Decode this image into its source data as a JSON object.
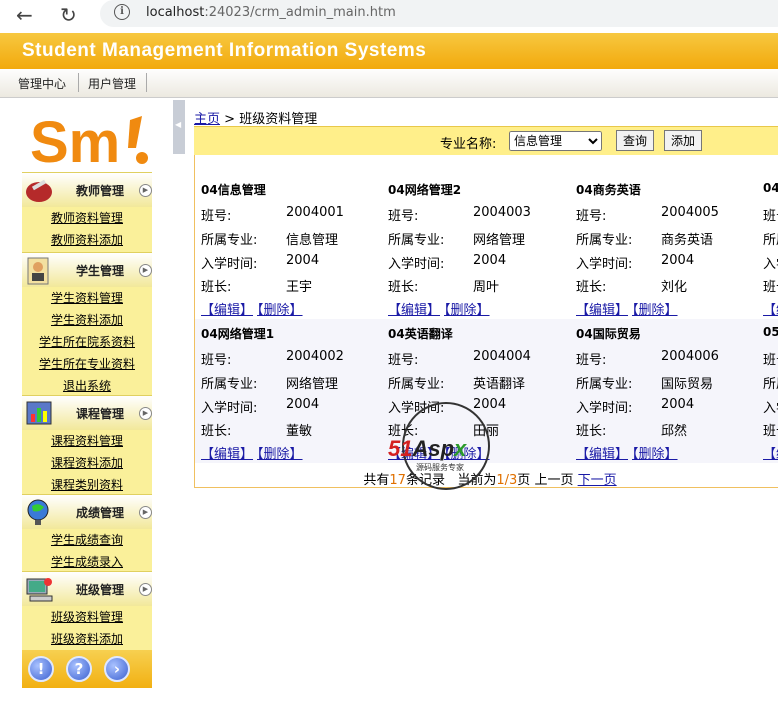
{
  "browser": {
    "url_host": "localhost",
    "url_rest": ":24023/crm_admin_main.htm"
  },
  "app": {
    "title": "Student Management Information Systems",
    "top_menu": [
      "管理中心",
      "用户管理"
    ]
  },
  "sidebar": {
    "sections": [
      {
        "label": "教师管理",
        "icon": "teacher-tools-icon",
        "items": [
          "教师资料管理",
          "教师资料添加"
        ]
      },
      {
        "label": "学生管理",
        "icon": "student-icon",
        "items": [
          "学生资料管理",
          "学生资料添加",
          "学生所在院系资料",
          "学生所在专业资料",
          "退出系统"
        ]
      },
      {
        "label": "课程管理",
        "icon": "course-chart-icon",
        "items": [
          "课程资料管理",
          "课程资料添加",
          "课程类别资料"
        ]
      },
      {
        "label": "成绩管理",
        "icon": "score-globe-icon",
        "items": [
          "学生成绩查询",
          "学生成绩录入"
        ]
      },
      {
        "label": "班级管理",
        "icon": "class-computer-icon",
        "items": [
          "班级资料管理",
          "班级资料添加"
        ]
      }
    ],
    "footer_icons": [
      "info-icon",
      "help-icon",
      "forward-icon"
    ]
  },
  "breadcrumb": {
    "home": "主页",
    "sep": ">",
    "current": "班级资料管理"
  },
  "toolbar": {
    "label": "专业名称:",
    "selected": "信息管理",
    "query_btn": "查询",
    "add_btn": "添加"
  },
  "labels": {
    "class_no": "班号:",
    "major": "所属专业:",
    "enroll": "入学时间:",
    "monitor": "班长:",
    "edit": "【编辑】",
    "delete": "【删除】"
  },
  "rows": [
    [
      {
        "name": "04信息管理",
        "no": "2004001",
        "major": "信息管理",
        "year": "2004",
        "monitor": "王宇"
      },
      {
        "name": "04网络管理2",
        "no": "2004003",
        "major": "网络管理",
        "year": "2004",
        "monitor": "周叶"
      },
      {
        "name": "04商务英语",
        "no": "2004005",
        "major": "商务英语",
        "year": "2004",
        "monitor": "刘化"
      },
      {
        "name": "04",
        "no": "",
        "major": "",
        "year": "",
        "monitor": ""
      }
    ],
    [
      {
        "name": "04网络管理1",
        "no": "2004002",
        "major": "网络管理",
        "year": "2004",
        "monitor": "董敏"
      },
      {
        "name": "04英语翻译",
        "no": "2004004",
        "major": "英语翻译",
        "year": "2004",
        "monitor": "田丽"
      },
      {
        "name": "04国际贸易",
        "no": "2004006",
        "major": "国际贸易",
        "year": "2004",
        "monitor": "邱然"
      },
      {
        "name": "05",
        "no": "",
        "major": "",
        "year": "",
        "monitor": ""
      }
    ]
  ],
  "pager": {
    "prefix": "共有",
    "total": "17",
    "suffix": "条记录",
    "current_prefix": "当前为",
    "current": "1/3",
    "current_suffix": "页",
    "prev": "上一页",
    "next": "下一页"
  },
  "watermark": {
    "brand_red": "51",
    "brand_dark": "Asp",
    "brand_green": "x",
    "tagline": "源码服务专家"
  },
  "colors": {
    "header": "#f2a90c",
    "sidebar_body": "#faf09a",
    "toolbar": "#ffef8a",
    "link": "#1a1aa6"
  }
}
